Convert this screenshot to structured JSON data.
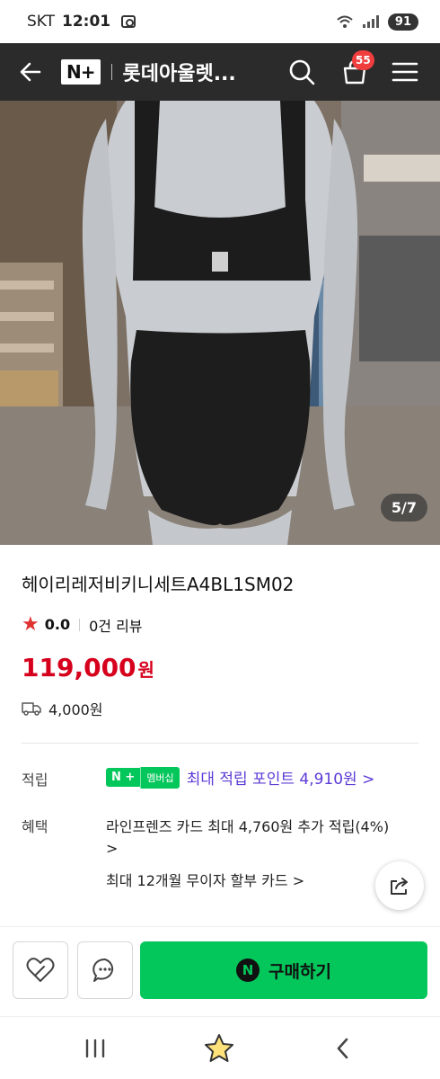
{
  "status_bar": {
    "carrier": "SKT",
    "time": "12:01",
    "battery": "91"
  },
  "header": {
    "logo": "N+",
    "store_name": "롯데아울렛...",
    "cart_count": "55"
  },
  "gallery": {
    "counter": "5/7"
  },
  "product": {
    "title": "헤이리레저비키니세트A4BL1SM02",
    "rating": "0.0",
    "review_count": "0건 리뷰",
    "price": "119,000",
    "currency": "원",
    "shipping_fee": "4,000원"
  },
  "points": {
    "label": "적립",
    "badge_logo": "N +",
    "badge_text": "멤버십",
    "text": "최대 적립 포인트 4,910원 >"
  },
  "benefits": {
    "label": "혜택",
    "line1": "라인프렌즈 카드 최대 4,760원 추가 적립(4%)",
    "line1_more": ">",
    "line2": "최대 12개월 무이자 할부 카드 >"
  },
  "actions": {
    "buy_icon": "N",
    "buy_label": "구매하기"
  },
  "colors": {
    "accent_green": "#03c75a",
    "price_red": "#d6001c",
    "point_purple": "#5c3bd6",
    "header_bg": "#2b2b2b"
  }
}
